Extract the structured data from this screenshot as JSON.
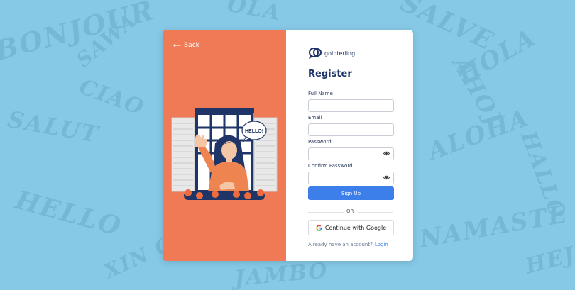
{
  "background": {
    "color": "#86c9e6",
    "words": [
      "BONJOUR",
      "CIAO",
      "SALVE",
      "HOLA",
      "SALUT",
      "ALOHA",
      "HELLO",
      "NAMASTE",
      "XIN CHAO",
      "HALLO",
      "OLA",
      "JAMBO",
      "AHOJ",
      "SAWA",
      "HEJ"
    ]
  },
  "back": {
    "label": "Back"
  },
  "illustration": {
    "speech": "HELLO!"
  },
  "brand": {
    "name": "gointerling"
  },
  "form": {
    "title": "Register",
    "fields": [
      {
        "label": "Full Name",
        "value": ""
      },
      {
        "label": "Email",
        "value": ""
      },
      {
        "label": "Password",
        "value": ""
      },
      {
        "label": "Confirm Password",
        "value": ""
      }
    ],
    "submit": "Sign Up",
    "divider": "OR",
    "google": "Continue with Google",
    "footer_text": "Already have an account?",
    "footer_link": "Login"
  },
  "colors": {
    "accent": "#3d7fea",
    "panel": "#f07a55",
    "heading": "#1e3468"
  },
  "icons": [
    "back-arrow-icon",
    "logo-icon",
    "eye-icon",
    "google-icon"
  ]
}
